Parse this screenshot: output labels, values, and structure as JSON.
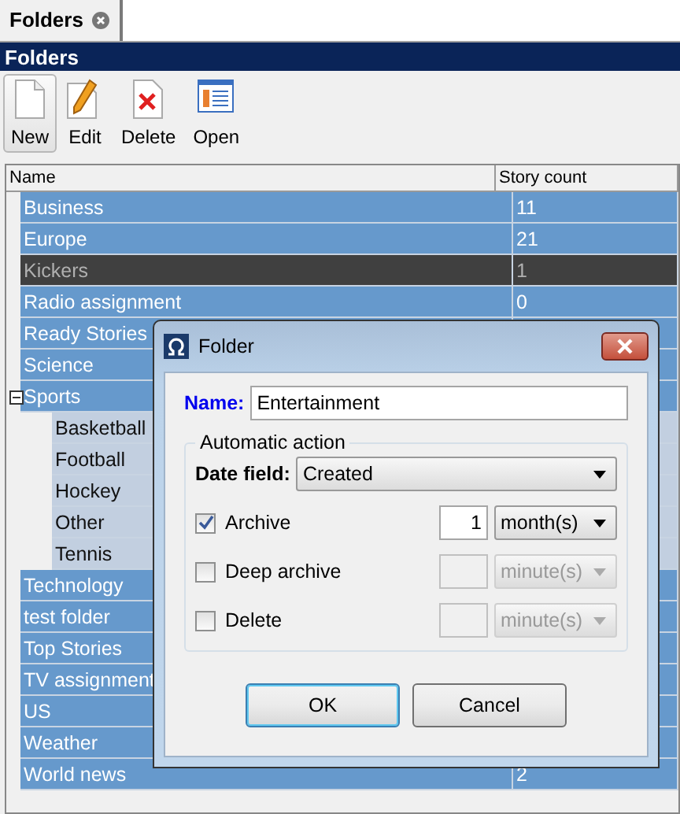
{
  "tab": {
    "label": "Folders"
  },
  "panel": {
    "title": "Folders"
  },
  "toolbar": [
    {
      "kind": "new",
      "label": "New",
      "selected": true
    },
    {
      "kind": "edit",
      "label": "Edit",
      "selected": false
    },
    {
      "kind": "delete",
      "label": "Delete",
      "selected": false
    },
    {
      "kind": "open",
      "label": "Open",
      "selected": false
    }
  ],
  "table": {
    "columns": [
      "Name",
      "Story count"
    ],
    "rows": [
      {
        "name": "Business",
        "count": "11",
        "selected": false
      },
      {
        "name": "Europe",
        "count": "21",
        "selected": false
      },
      {
        "name": "Kickers",
        "count": "1",
        "selected": true
      },
      {
        "name": "Radio assignment",
        "count": "0",
        "selected": false
      },
      {
        "name": "Ready Stories",
        "selected": false
      },
      {
        "name": "Science",
        "selected": false
      },
      {
        "name": "Sports",
        "selected": false,
        "expanded": true,
        "children": [
          {
            "name": "Basketball",
            "selected": false
          },
          {
            "name": "Football",
            "selected": false
          },
          {
            "name": "Hockey",
            "selected": false
          },
          {
            "name": "Other",
            "selected": false
          },
          {
            "name": "Tennis",
            "selected": false
          }
        ]
      },
      {
        "name": "Technology",
        "selected": false
      },
      {
        "name": "test folder",
        "selected": false
      },
      {
        "name": "Top Stories",
        "selected": false
      },
      {
        "name": "TV assignment",
        "selected": false
      },
      {
        "name": "US",
        "selected": false
      },
      {
        "name": "Weather",
        "selected": false
      },
      {
        "name": "World news",
        "count": "2",
        "selected": false
      }
    ]
  },
  "dialog": {
    "title": "Folder",
    "name_label": "Name:",
    "name_value": "Entertainment",
    "group_title": "Automatic action",
    "date_label": "Date field:",
    "date_value": "Created",
    "actions": [
      {
        "label": "Archive",
        "checked": true,
        "amount": "1",
        "unit": "month(s)"
      },
      {
        "label": "Deep archive",
        "checked": false,
        "unit": "minute(s)"
      },
      {
        "label": "Delete",
        "checked": false,
        "unit": "minute(s)"
      }
    ],
    "buttons": [
      {
        "label": "OK",
        "selected": true
      },
      {
        "label": "Cancel",
        "selected": false
      }
    ]
  }
}
